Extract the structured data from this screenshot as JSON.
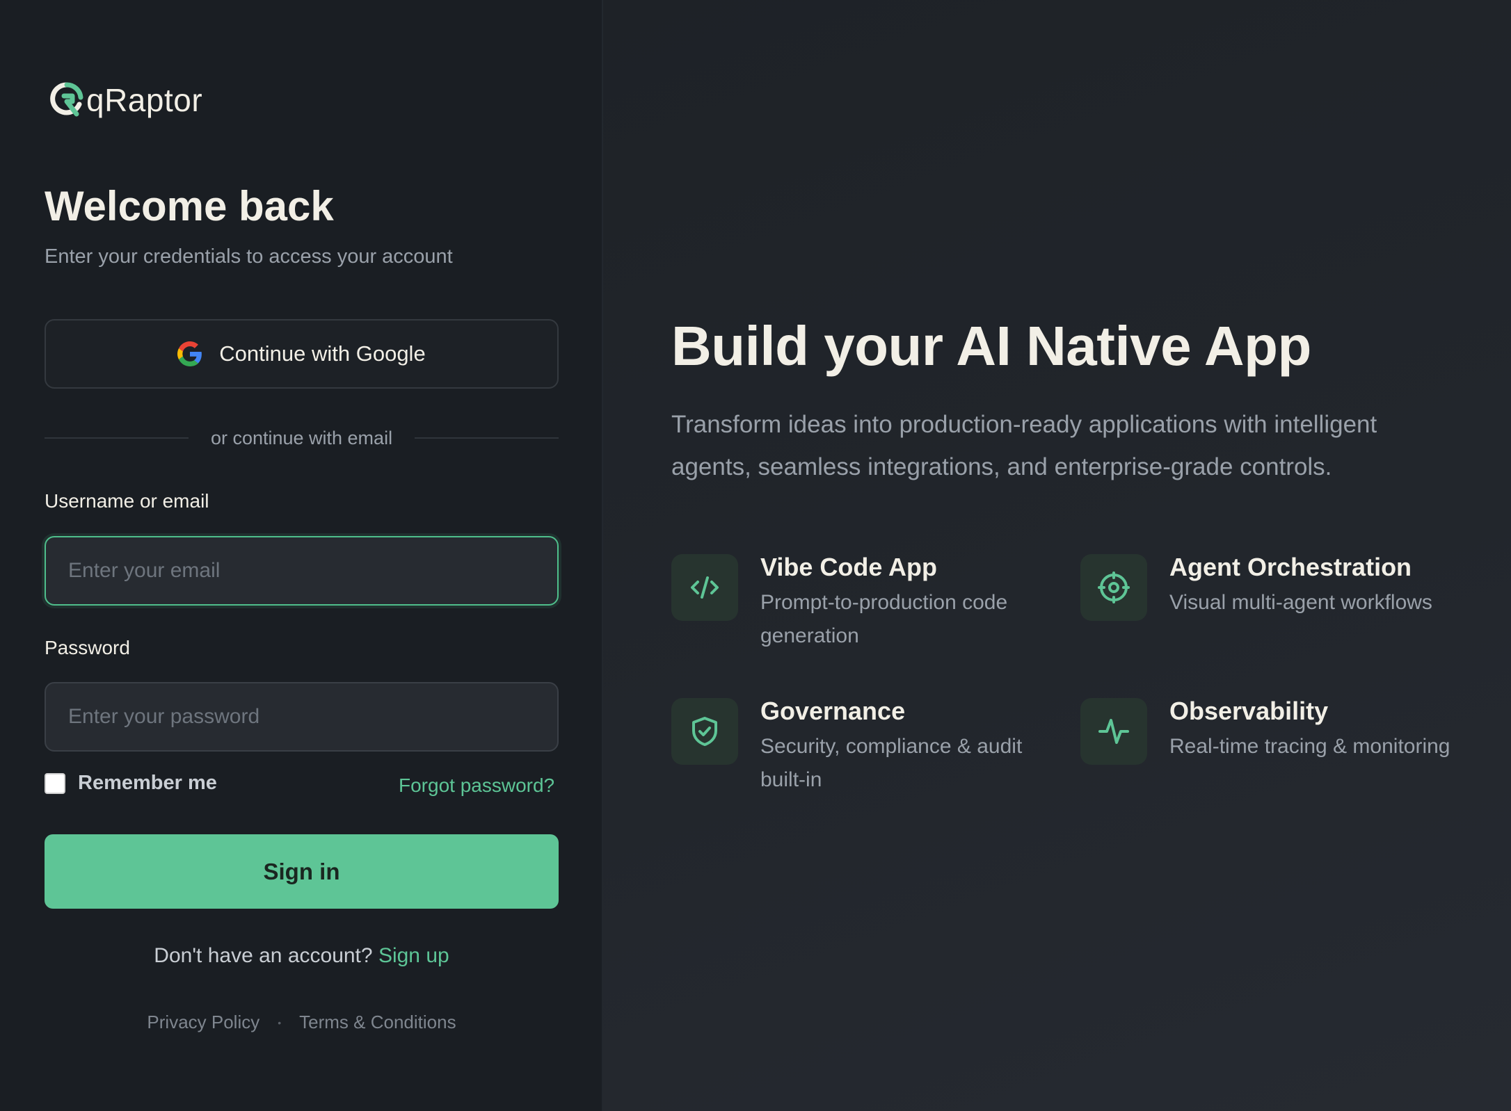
{
  "brand": {
    "name": "qRaptor",
    "accent_color": "#5ec596"
  },
  "login": {
    "title": "Welcome back",
    "subtitle": "Enter your credentials to access your account",
    "google_button": "Continue with Google",
    "divider": "or continue with email",
    "username_label": "Username or email",
    "username_placeholder": "Enter your email",
    "password_label": "Password",
    "password_placeholder": "Enter your password",
    "remember_me": "Remember me",
    "forgot_password": "Forgot password?",
    "sign_in": "Sign in",
    "no_account": "Don't have an account?",
    "sign_up": "Sign up",
    "privacy_policy": "Privacy Policy",
    "footer_separator": "•",
    "terms": "Terms & Conditions"
  },
  "hero": {
    "title": "Build your AI Native App",
    "description": "Transform ideas into production-ready applications with intelligent agents, seamless integrations, and enterprise-grade controls.",
    "features": [
      {
        "icon": "code-icon",
        "title": "Vibe Code App",
        "description": "Prompt-to-production code generation"
      },
      {
        "icon": "target-icon",
        "title": "Agent Orchestration",
        "description": "Visual multi-agent workflows"
      },
      {
        "icon": "shield-check-icon",
        "title": "Governance",
        "description": "Security, compliance & audit built-in"
      },
      {
        "icon": "activity-icon",
        "title": "Observability",
        "description": "Real-time tracing & monitoring"
      }
    ]
  }
}
